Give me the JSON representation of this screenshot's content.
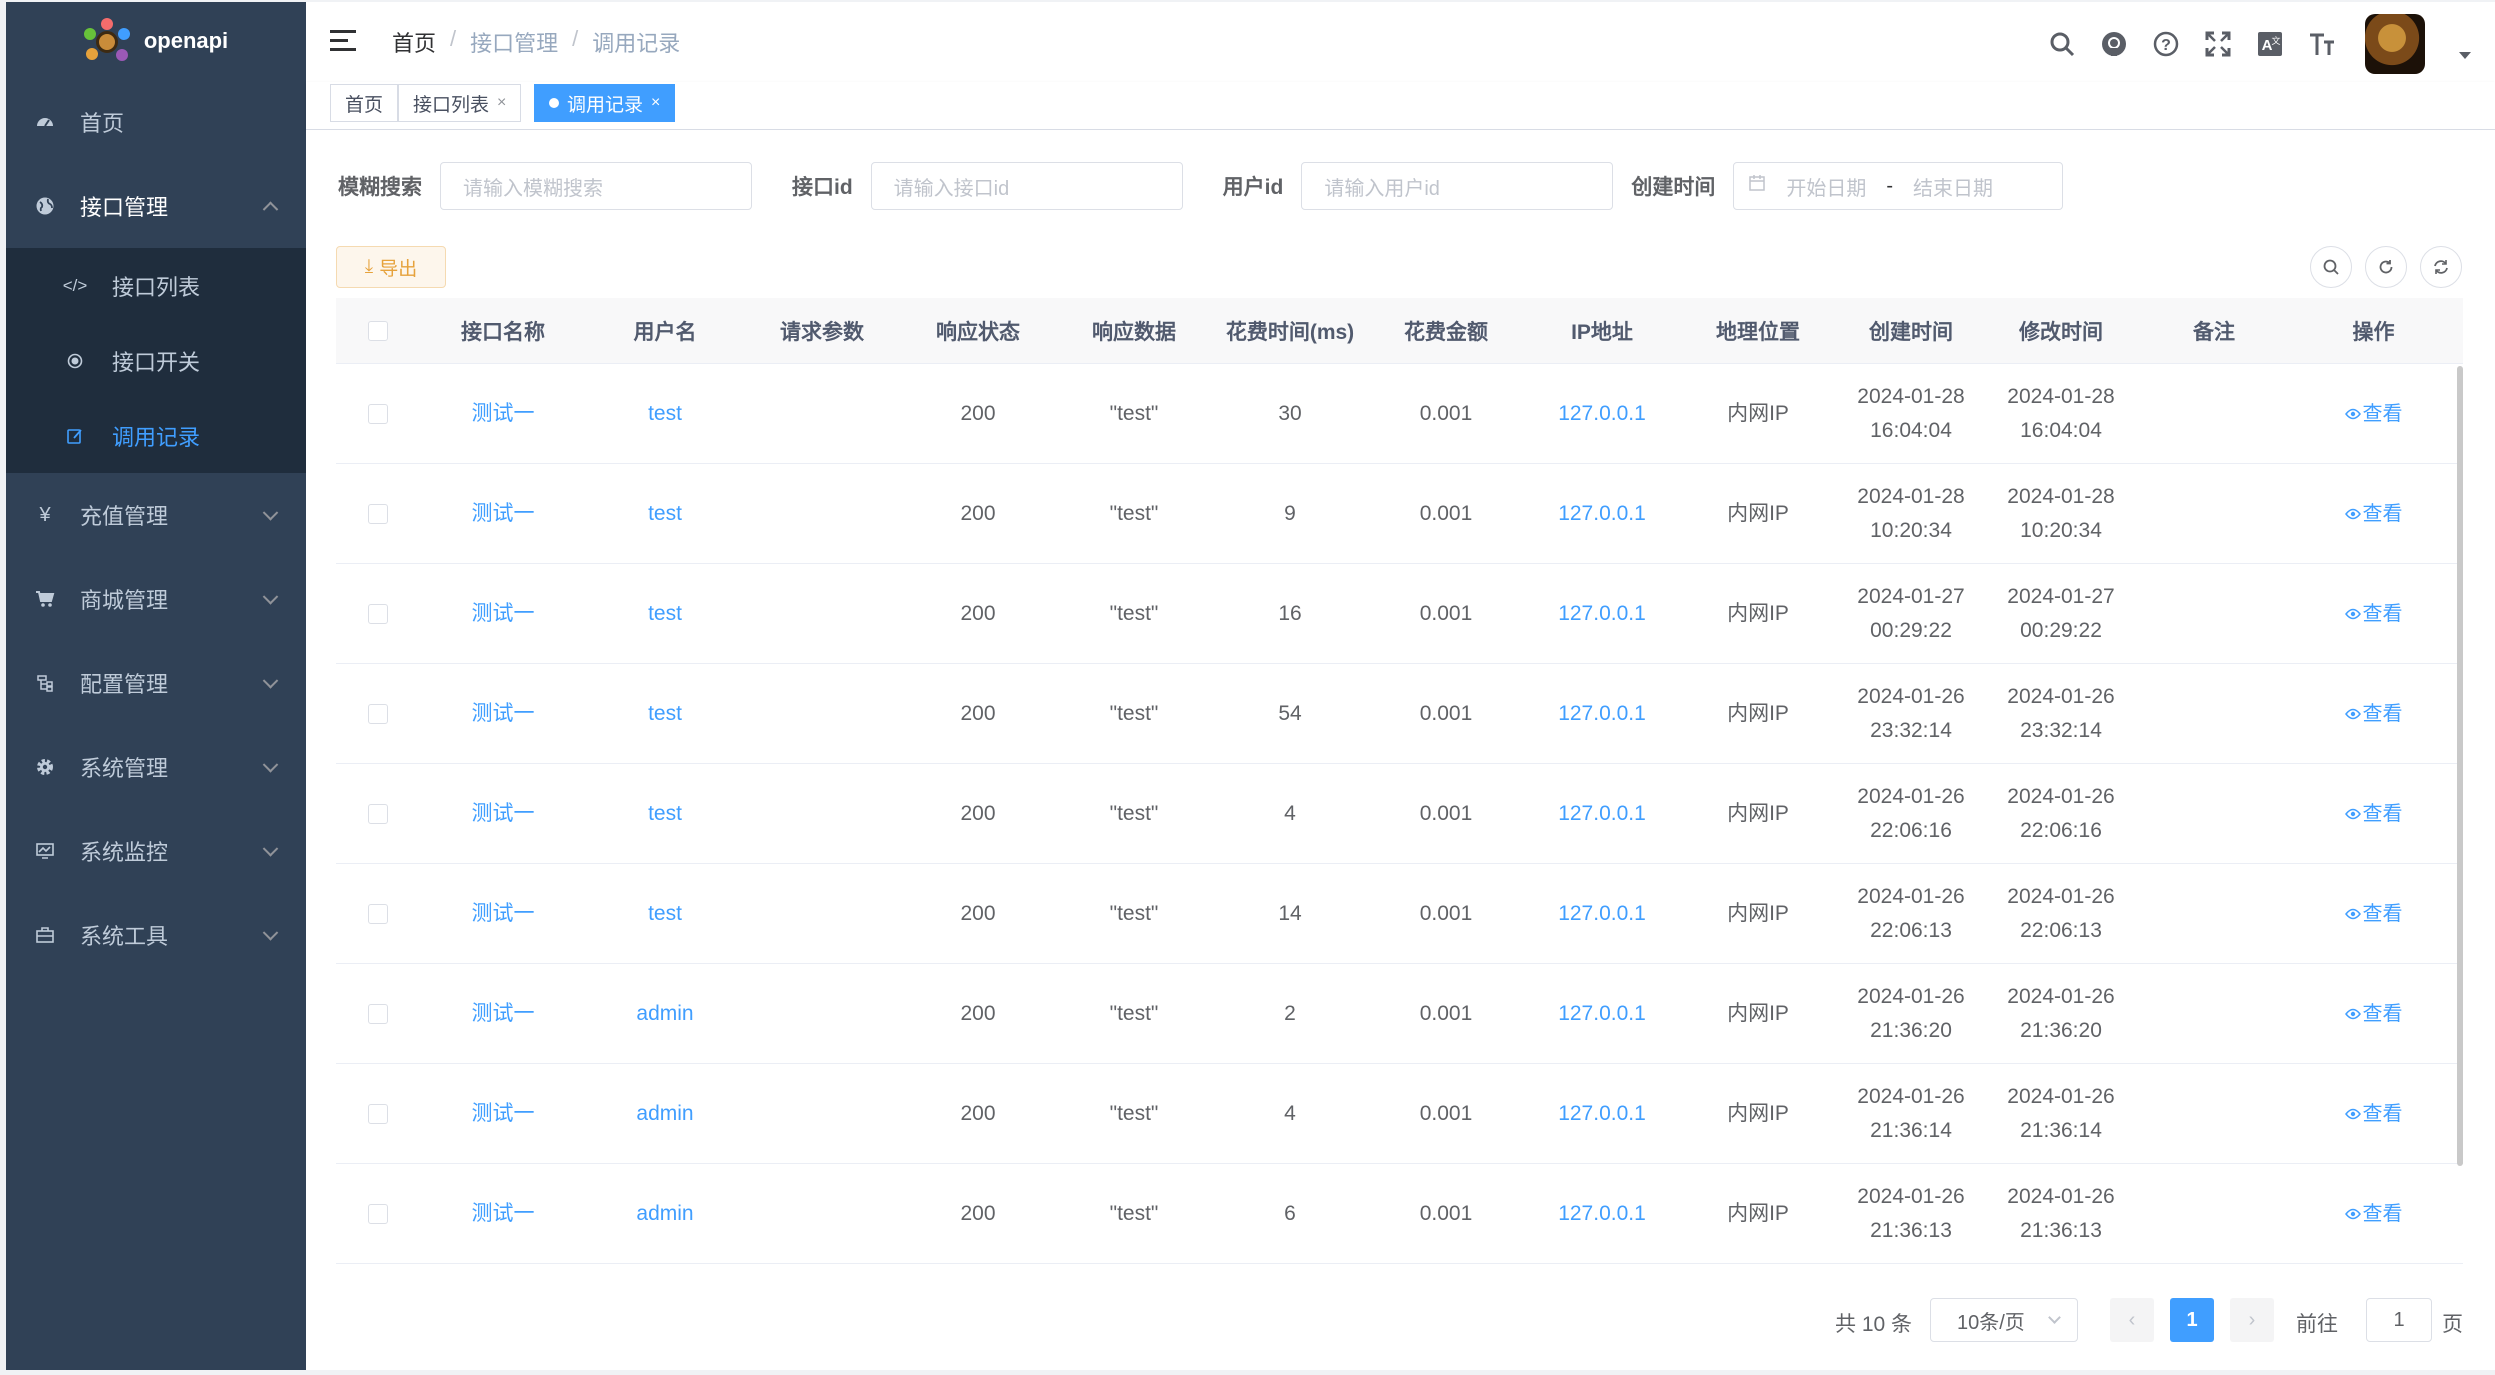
{
  "app": {
    "name": "openapi"
  },
  "colors": {
    "sidebar_bg": "#304156",
    "submenu_bg": "#1f2d3d",
    "primary": "#409eff",
    "warning": "#e6a23c"
  },
  "sidebar": {
    "items": [
      {
        "label": "首页",
        "icon": "dashboard-icon"
      },
      {
        "label": "接口管理",
        "icon": "globe-icon",
        "expanded": true,
        "children": [
          {
            "label": "接口列表",
            "icon": "code-icon"
          },
          {
            "label": "接口开关",
            "icon": "radio-icon"
          },
          {
            "label": "调用记录",
            "icon": "edit-icon",
            "active": true
          }
        ]
      },
      {
        "label": "充值管理",
        "icon": "yen-icon"
      },
      {
        "label": "商城管理",
        "icon": "cart-icon"
      },
      {
        "label": "配置管理",
        "icon": "tree-icon"
      },
      {
        "label": "系统管理",
        "icon": "gear-icon"
      },
      {
        "label": "系统监控",
        "icon": "monitor-icon"
      },
      {
        "label": "系统工具",
        "icon": "toolbox-icon"
      }
    ]
  },
  "header": {
    "breadcrumb": [
      "首页",
      "接口管理",
      "调用记录"
    ],
    "tools": [
      "search-icon",
      "github-icon",
      "question-icon",
      "fullscreen-icon",
      "translate-icon",
      "font-size-icon"
    ]
  },
  "tags": [
    {
      "label": "首页",
      "closable": false
    },
    {
      "label": "接口列表",
      "closable": true,
      "close": "×"
    },
    {
      "label": "调用记录",
      "closable": true,
      "active": true,
      "close": "×"
    }
  ],
  "search": {
    "fuzzy": {
      "label": "模糊搜索",
      "placeholder": "请输入模糊搜索"
    },
    "api_id": {
      "label": "接口id",
      "placeholder": "请输入接口id"
    },
    "user_id": {
      "label": "用户id",
      "placeholder": "请输入用户id"
    },
    "created": {
      "label": "创建时间",
      "start_placeholder": "开始日期",
      "separator": "-",
      "end_placeholder": "结束日期"
    }
  },
  "toolbar": {
    "export_label": "导出",
    "export_icon": "⤓"
  },
  "table": {
    "columns": [
      "接口名称",
      "用户名",
      "请求参数",
      "响应状态",
      "响应数据",
      "花费时间(ms)",
      "花费金额",
      "IP地址",
      "地理位置",
      "创建时间",
      "修改时间",
      "备注",
      "操作"
    ],
    "action_label": "查看",
    "rows": [
      {
        "name": "测试一",
        "user": "test",
        "params": "",
        "status": "200",
        "data": "\"test\"",
        "time": "30",
        "cost": "0.001",
        "ip": "127.0.0.1",
        "geo": "内网IP",
        "created_date": "2024-01-28",
        "created_time": "16:04:04",
        "updated_date": "2024-01-28",
        "updated_time": "16:04:04",
        "remark": ""
      },
      {
        "name": "测试一",
        "user": "test",
        "params": "",
        "status": "200",
        "data": "\"test\"",
        "time": "9",
        "cost": "0.001",
        "ip": "127.0.0.1",
        "geo": "内网IP",
        "created_date": "2024-01-28",
        "created_time": "10:20:34",
        "updated_date": "2024-01-28",
        "updated_time": "10:20:34",
        "remark": ""
      },
      {
        "name": "测试一",
        "user": "test",
        "params": "",
        "status": "200",
        "data": "\"test\"",
        "time": "16",
        "cost": "0.001",
        "ip": "127.0.0.1",
        "geo": "内网IP",
        "created_date": "2024-01-27",
        "created_time": "00:29:22",
        "updated_date": "2024-01-27",
        "updated_time": "00:29:22",
        "remark": ""
      },
      {
        "name": "测试一",
        "user": "test",
        "params": "",
        "status": "200",
        "data": "\"test\"",
        "time": "54",
        "cost": "0.001",
        "ip": "127.0.0.1",
        "geo": "内网IP",
        "created_date": "2024-01-26",
        "created_time": "23:32:14",
        "updated_date": "2024-01-26",
        "updated_time": "23:32:14",
        "remark": ""
      },
      {
        "name": "测试一",
        "user": "test",
        "params": "",
        "status": "200",
        "data": "\"test\"",
        "time": "4",
        "cost": "0.001",
        "ip": "127.0.0.1",
        "geo": "内网IP",
        "created_date": "2024-01-26",
        "created_time": "22:06:16",
        "updated_date": "2024-01-26",
        "updated_time": "22:06:16",
        "remark": ""
      },
      {
        "name": "测试一",
        "user": "test",
        "params": "",
        "status": "200",
        "data": "\"test\"",
        "time": "14",
        "cost": "0.001",
        "ip": "127.0.0.1",
        "geo": "内网IP",
        "created_date": "2024-01-26",
        "created_time": "22:06:13",
        "updated_date": "2024-01-26",
        "updated_time": "22:06:13",
        "remark": ""
      },
      {
        "name": "测试一",
        "user": "admin",
        "params": "",
        "status": "200",
        "data": "\"test\"",
        "time": "2",
        "cost": "0.001",
        "ip": "127.0.0.1",
        "geo": "内网IP",
        "created_date": "2024-01-26",
        "created_time": "21:36:20",
        "updated_date": "2024-01-26",
        "updated_time": "21:36:20",
        "remark": ""
      },
      {
        "name": "测试一",
        "user": "admin",
        "params": "",
        "status": "200",
        "data": "\"test\"",
        "time": "4",
        "cost": "0.001",
        "ip": "127.0.0.1",
        "geo": "内网IP",
        "created_date": "2024-01-26",
        "created_time": "21:36:14",
        "updated_date": "2024-01-26",
        "updated_time": "21:36:14",
        "remark": ""
      },
      {
        "name": "测试一",
        "user": "admin",
        "params": "",
        "status": "200",
        "data": "\"test\"",
        "time": "6",
        "cost": "0.001",
        "ip": "127.0.0.1",
        "geo": "内网IP",
        "created_date": "2024-01-26",
        "created_time": "21:36:13",
        "updated_date": "2024-01-26",
        "updated_time": "21:36:13",
        "remark": ""
      }
    ]
  },
  "pagination": {
    "total_label": "共 10 条",
    "page_size": "10条/页",
    "prev": "‹",
    "current": "1",
    "next": "›",
    "goto_label": "前往",
    "goto_value": "1",
    "page_suffix": "页"
  }
}
